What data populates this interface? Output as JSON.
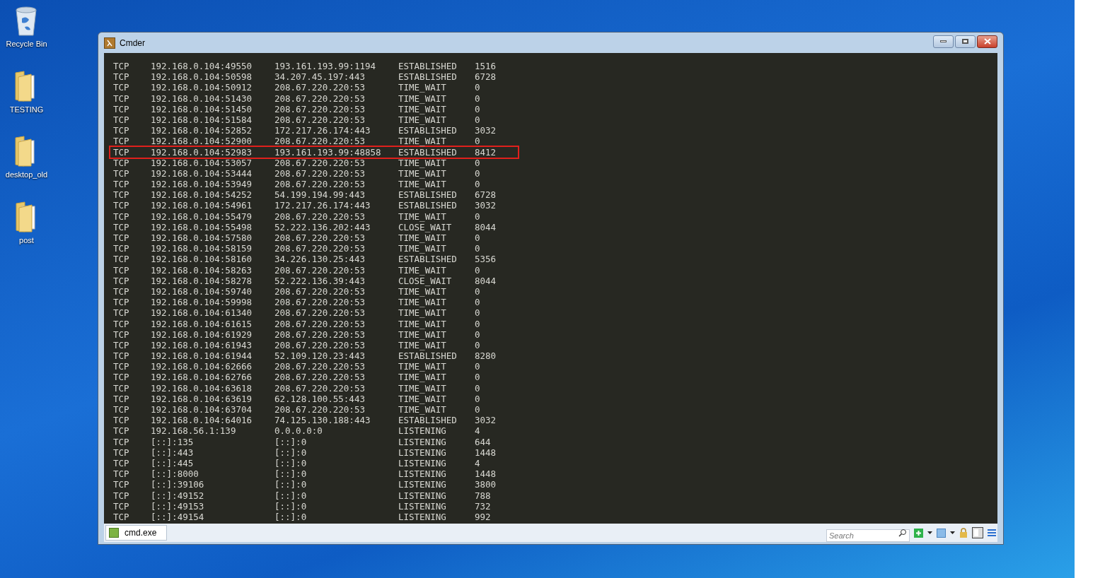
{
  "desktop_icons": [
    {
      "kind": "bin",
      "label": "Recycle Bin"
    },
    {
      "kind": "folder",
      "label": "TESTING"
    },
    {
      "kind": "folder",
      "label": "desktop_old"
    },
    {
      "kind": "folder",
      "label": "post"
    }
  ],
  "window": {
    "title": "Cmder"
  },
  "connections": [
    {
      "proto": "TCP",
      "local": "192.168.0.104:49550",
      "foreign": "193.161.193.99:1194",
      "state": "ESTABLISHED",
      "pid": "1516",
      "highlighted": false
    },
    {
      "proto": "TCP",
      "local": "192.168.0.104:50598",
      "foreign": "34.207.45.197:443",
      "state": "ESTABLISHED",
      "pid": "6728",
      "highlighted": false
    },
    {
      "proto": "TCP",
      "local": "192.168.0.104:50912",
      "foreign": "208.67.220.220:53",
      "state": "TIME_WAIT",
      "pid": "0",
      "highlighted": false
    },
    {
      "proto": "TCP",
      "local": "192.168.0.104:51430",
      "foreign": "208.67.220.220:53",
      "state": "TIME_WAIT",
      "pid": "0",
      "highlighted": false
    },
    {
      "proto": "TCP",
      "local": "192.168.0.104:51450",
      "foreign": "208.67.220.220:53",
      "state": "TIME_WAIT",
      "pid": "0",
      "highlighted": false
    },
    {
      "proto": "TCP",
      "local": "192.168.0.104:51584",
      "foreign": "208.67.220.220:53",
      "state": "TIME_WAIT",
      "pid": "0",
      "highlighted": false
    },
    {
      "proto": "TCP",
      "local": "192.168.0.104:52852",
      "foreign": "172.217.26.174:443",
      "state": "ESTABLISHED",
      "pid": "3032",
      "highlighted": false
    },
    {
      "proto": "TCP",
      "local": "192.168.0.104:52900",
      "foreign": "208.67.220.220:53",
      "state": "TIME_WAIT",
      "pid": "0",
      "highlighted": false
    },
    {
      "proto": "TCP",
      "local": "192.168.0.104:52983",
      "foreign": "193.161.193.99:48858",
      "state": "ESTABLISHED",
      "pid": "8412",
      "highlighted": true
    },
    {
      "proto": "TCP",
      "local": "192.168.0.104:53057",
      "foreign": "208.67.220.220:53",
      "state": "TIME_WAIT",
      "pid": "0",
      "highlighted": false
    },
    {
      "proto": "TCP",
      "local": "192.168.0.104:53444",
      "foreign": "208.67.220.220:53",
      "state": "TIME_WAIT",
      "pid": "0",
      "highlighted": false
    },
    {
      "proto": "TCP",
      "local": "192.168.0.104:53949",
      "foreign": "208.67.220.220:53",
      "state": "TIME_WAIT",
      "pid": "0",
      "highlighted": false
    },
    {
      "proto": "TCP",
      "local": "192.168.0.104:54252",
      "foreign": "54.199.194.99:443",
      "state": "ESTABLISHED",
      "pid": "6728",
      "highlighted": false
    },
    {
      "proto": "TCP",
      "local": "192.168.0.104:54961",
      "foreign": "172.217.26.174:443",
      "state": "ESTABLISHED",
      "pid": "3032",
      "highlighted": false
    },
    {
      "proto": "TCP",
      "local": "192.168.0.104:55479",
      "foreign": "208.67.220.220:53",
      "state": "TIME_WAIT",
      "pid": "0",
      "highlighted": false
    },
    {
      "proto": "TCP",
      "local": "192.168.0.104:55498",
      "foreign": "52.222.136.202:443",
      "state": "CLOSE_WAIT",
      "pid": "8044",
      "highlighted": false
    },
    {
      "proto": "TCP",
      "local": "192.168.0.104:57580",
      "foreign": "208.67.220.220:53",
      "state": "TIME_WAIT",
      "pid": "0",
      "highlighted": false
    },
    {
      "proto": "TCP",
      "local": "192.168.0.104:58159",
      "foreign": "208.67.220.220:53",
      "state": "TIME_WAIT",
      "pid": "0",
      "highlighted": false
    },
    {
      "proto": "TCP",
      "local": "192.168.0.104:58160",
      "foreign": "34.226.130.25:443",
      "state": "ESTABLISHED",
      "pid": "5356",
      "highlighted": false
    },
    {
      "proto": "TCP",
      "local": "192.168.0.104:58263",
      "foreign": "208.67.220.220:53",
      "state": "TIME_WAIT",
      "pid": "0",
      "highlighted": false
    },
    {
      "proto": "TCP",
      "local": "192.168.0.104:58278",
      "foreign": "52.222.136.39:443",
      "state": "CLOSE_WAIT",
      "pid": "8044",
      "highlighted": false
    },
    {
      "proto": "TCP",
      "local": "192.168.0.104:59740",
      "foreign": "208.67.220.220:53",
      "state": "TIME_WAIT",
      "pid": "0",
      "highlighted": false
    },
    {
      "proto": "TCP",
      "local": "192.168.0.104:59998",
      "foreign": "208.67.220.220:53",
      "state": "TIME_WAIT",
      "pid": "0",
      "highlighted": false
    },
    {
      "proto": "TCP",
      "local": "192.168.0.104:61340",
      "foreign": "208.67.220.220:53",
      "state": "TIME_WAIT",
      "pid": "0",
      "highlighted": false
    },
    {
      "proto": "TCP",
      "local": "192.168.0.104:61615",
      "foreign": "208.67.220.220:53",
      "state": "TIME_WAIT",
      "pid": "0",
      "highlighted": false
    },
    {
      "proto": "TCP",
      "local": "192.168.0.104:61929",
      "foreign": "208.67.220.220:53",
      "state": "TIME_WAIT",
      "pid": "0",
      "highlighted": false
    },
    {
      "proto": "TCP",
      "local": "192.168.0.104:61943",
      "foreign": "208.67.220.220:53",
      "state": "TIME_WAIT",
      "pid": "0",
      "highlighted": false
    },
    {
      "proto": "TCP",
      "local": "192.168.0.104:61944",
      "foreign": "52.109.120.23:443",
      "state": "ESTABLISHED",
      "pid": "8280",
      "highlighted": false
    },
    {
      "proto": "TCP",
      "local": "192.168.0.104:62666",
      "foreign": "208.67.220.220:53",
      "state": "TIME_WAIT",
      "pid": "0",
      "highlighted": false
    },
    {
      "proto": "TCP",
      "local": "192.168.0.104:62766",
      "foreign": "208.67.220.220:53",
      "state": "TIME_WAIT",
      "pid": "0",
      "highlighted": false
    },
    {
      "proto": "TCP",
      "local": "192.168.0.104:63618",
      "foreign": "208.67.220.220:53",
      "state": "TIME_WAIT",
      "pid": "0",
      "highlighted": false
    },
    {
      "proto": "TCP",
      "local": "192.168.0.104:63619",
      "foreign": "62.128.100.55:443",
      "state": "TIME_WAIT",
      "pid": "0",
      "highlighted": false
    },
    {
      "proto": "TCP",
      "local": "192.168.0.104:63704",
      "foreign": "208.67.220.220:53",
      "state": "TIME_WAIT",
      "pid": "0",
      "highlighted": false
    },
    {
      "proto": "TCP",
      "local": "192.168.0.104:64016",
      "foreign": "74.125.130.188:443",
      "state": "ESTABLISHED",
      "pid": "3032",
      "highlighted": false
    },
    {
      "proto": "TCP",
      "local": "192.168.56.1:139",
      "foreign": "0.0.0.0:0",
      "state": "LISTENING",
      "pid": "4",
      "highlighted": false
    },
    {
      "proto": "TCP",
      "local": "[::]:135",
      "foreign": "[::]:0",
      "state": "LISTENING",
      "pid": "644",
      "highlighted": false
    },
    {
      "proto": "TCP",
      "local": "[::]:443",
      "foreign": "[::]:0",
      "state": "LISTENING",
      "pid": "1448",
      "highlighted": false
    },
    {
      "proto": "TCP",
      "local": "[::]:445",
      "foreign": "[::]:0",
      "state": "LISTENING",
      "pid": "4",
      "highlighted": false
    },
    {
      "proto": "TCP",
      "local": "[::]:8000",
      "foreign": "[::]:0",
      "state": "LISTENING",
      "pid": "1448",
      "highlighted": false
    },
    {
      "proto": "TCP",
      "local": "[::]:39106",
      "foreign": "[::]:0",
      "state": "LISTENING",
      "pid": "3800",
      "highlighted": false
    },
    {
      "proto": "TCP",
      "local": "[::]:49152",
      "foreign": "[::]:0",
      "state": "LISTENING",
      "pid": "788",
      "highlighted": false
    },
    {
      "proto": "TCP",
      "local": "[::]:49153",
      "foreign": "[::]:0",
      "state": "LISTENING",
      "pid": "732",
      "highlighted": false
    },
    {
      "proto": "TCP",
      "local": "[::]:49154",
      "foreign": "[::]:0",
      "state": "LISTENING",
      "pid": "992",
      "highlighted": false
    }
  ],
  "console_tab": {
    "label": "cmd.exe",
    "selected": true
  },
  "search": {
    "placeholder": "Search"
  }
}
